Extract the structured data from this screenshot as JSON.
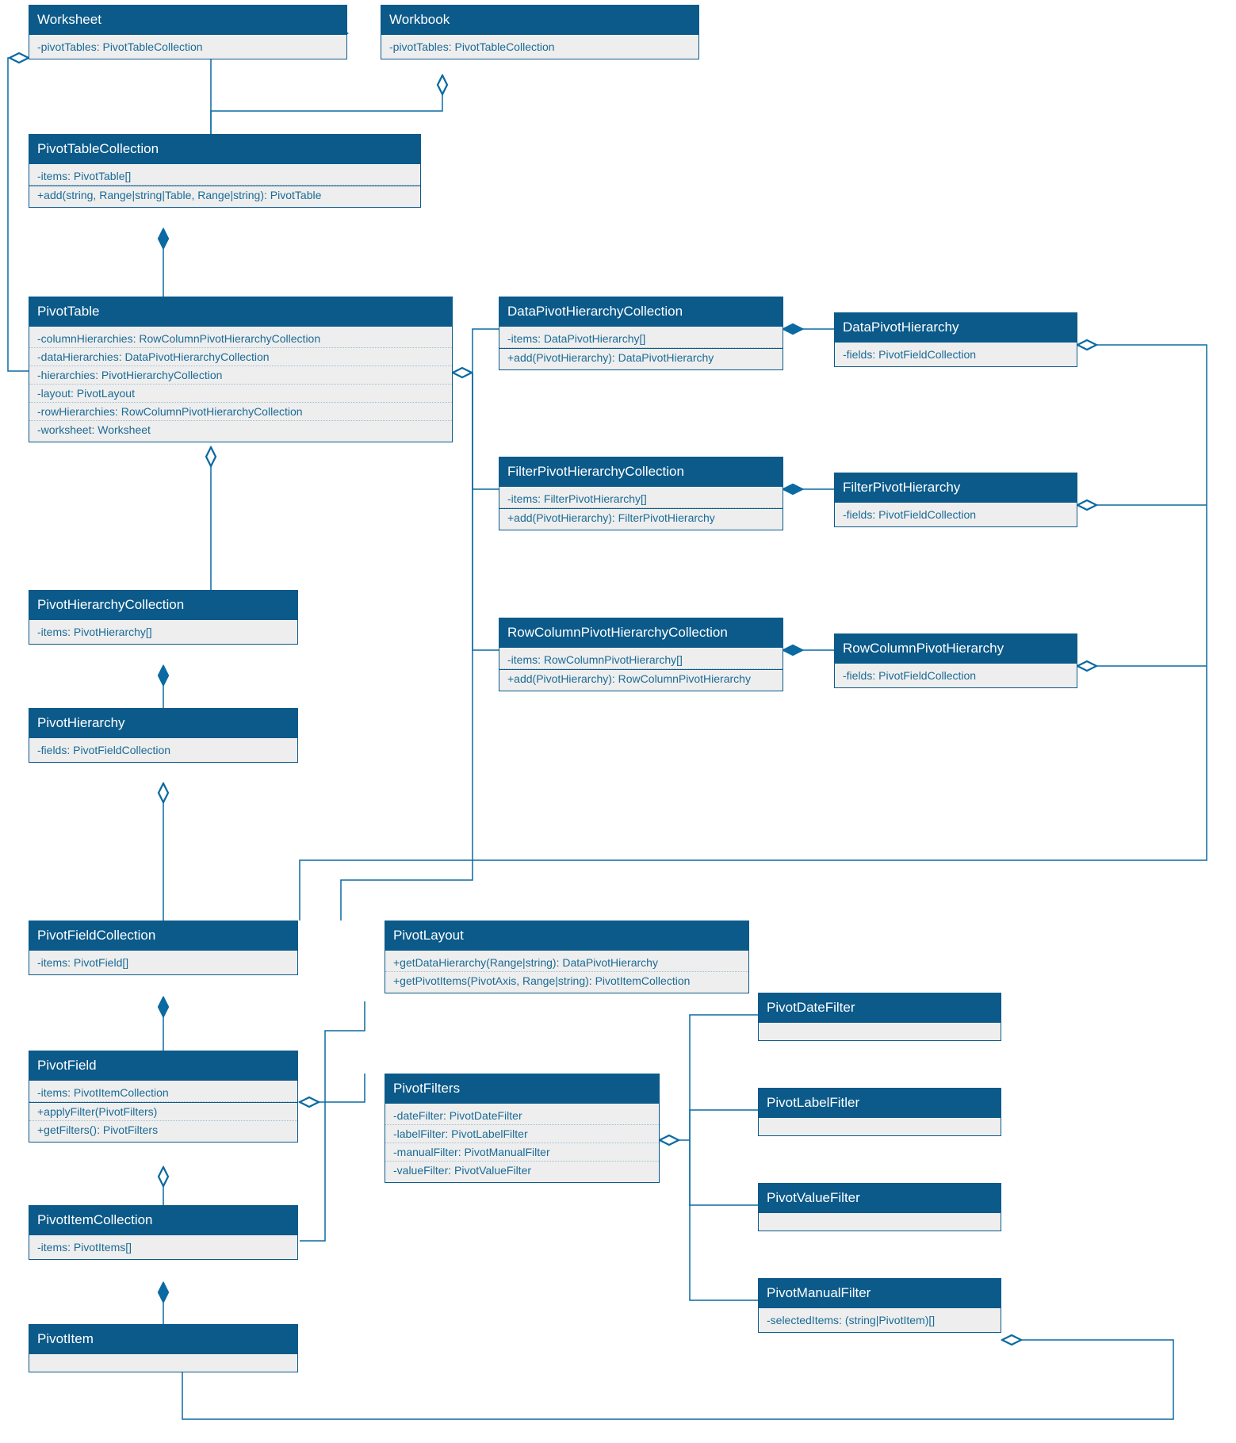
{
  "colors": {
    "header_bg": "#0b5a8a",
    "header_text": "#ffffff",
    "body_bg": "#eeeeee",
    "member_text": "#1a6b96",
    "connector": "#0b6aa2"
  },
  "classes": {
    "worksheet": {
      "title": "Worksheet",
      "members": [
        "-pivotTables: PivotTableCollection"
      ]
    },
    "workbook": {
      "title": "Workbook",
      "members": [
        "-pivotTables: PivotTableCollection"
      ]
    },
    "pivotTableCollection": {
      "title": "PivotTableCollection",
      "members": [
        "-items: PivotTable[]",
        "+add(string, Range|string|Table, Range|string): PivotTable"
      ]
    },
    "pivotTable": {
      "title": "PivotTable",
      "members": [
        "-columnHierarchies: RowColumnPivotHierarchyCollection",
        "-dataHierarchies: DataPivotHierarchyCollection",
        "-hierarchies: PivotHierarchyCollection",
        "-layout: PivotLayout",
        "-rowHierarchies: RowColumnPivotHierarchyCollection",
        "-worksheet: Worksheet"
      ]
    },
    "dataPivotHierarchyCollection": {
      "title": "DataPivotHierarchyCollection",
      "members": [
        "-items: DataPivotHierarchy[]",
        "+add(PivotHierarchy): DataPivotHierarchy"
      ]
    },
    "dataPivotHierarchy": {
      "title": "DataPivotHierarchy",
      "members": [
        "-fields: PivotFieldCollection"
      ]
    },
    "filterPivotHierarchyCollection": {
      "title": "FilterPivotHierarchyCollection",
      "members": [
        "-items: FilterPivotHierarchy[]",
        "+add(PivotHierarchy): FilterPivotHierarchy"
      ]
    },
    "filterPivotHierarchy": {
      "title": "FilterPivotHierarchy",
      "members": [
        "-fields: PivotFieldCollection"
      ]
    },
    "rowColumnPivotHierarchyCollection": {
      "title": "RowColumnPivotHierarchyCollection",
      "members": [
        "-items: RowColumnPivotHierarchy[]",
        "+add(PivotHierarchy): RowColumnPivotHierarchy"
      ]
    },
    "rowColumnPivotHierarchy": {
      "title": "RowColumnPivotHierarchy",
      "members": [
        "-fields: PivotFieldCollection"
      ]
    },
    "pivotHierarchyCollection": {
      "title": "PivotHierarchyCollection",
      "members": [
        "-items: PivotHierarchy[]"
      ]
    },
    "pivotHierarchy": {
      "title": "PivotHierarchy",
      "members": [
        "-fields: PivotFieldCollection"
      ]
    },
    "pivotFieldCollection": {
      "title": "PivotFieldCollection",
      "members": [
        "-items: PivotField[]"
      ]
    },
    "pivotLayout": {
      "title": "PivotLayout",
      "members": [
        "+getDataHierarchy(Range|string): DataPivotHierarchy",
        "+getPivotItems(PivotAxis, Range|string): PivotItemCollection"
      ]
    },
    "pivotField": {
      "title": "PivotField",
      "members": [
        "-items: PivotItemCollection",
        "+applyFilter(PivotFilters)",
        "+getFilters(): PivotFilters"
      ]
    },
    "pivotFilters": {
      "title": "PivotFilters",
      "members": [
        "-dateFilter: PivotDateFilter",
        "-labelFilter: PivotLabelFilter",
        "-manualFilter: PivotManualFilter",
        "-valueFilter: PivotValueFilter"
      ]
    },
    "pivotDateFilter": {
      "title": "PivotDateFilter",
      "members": []
    },
    "pivotLabelFilter": {
      "title": "PivotLabelFitler",
      "members": []
    },
    "pivotValueFilter": {
      "title": "PivotValueFilter",
      "members": []
    },
    "pivotManualFilter": {
      "title": "PivotManualFilter",
      "members": [
        "-selectedItems: (string|PivotItem)[]"
      ]
    },
    "pivotItemCollection": {
      "title": "PivotItemCollection",
      "members": [
        "-items: PivotItems[]"
      ]
    },
    "pivotItem": {
      "title": "PivotItem",
      "members": []
    }
  }
}
